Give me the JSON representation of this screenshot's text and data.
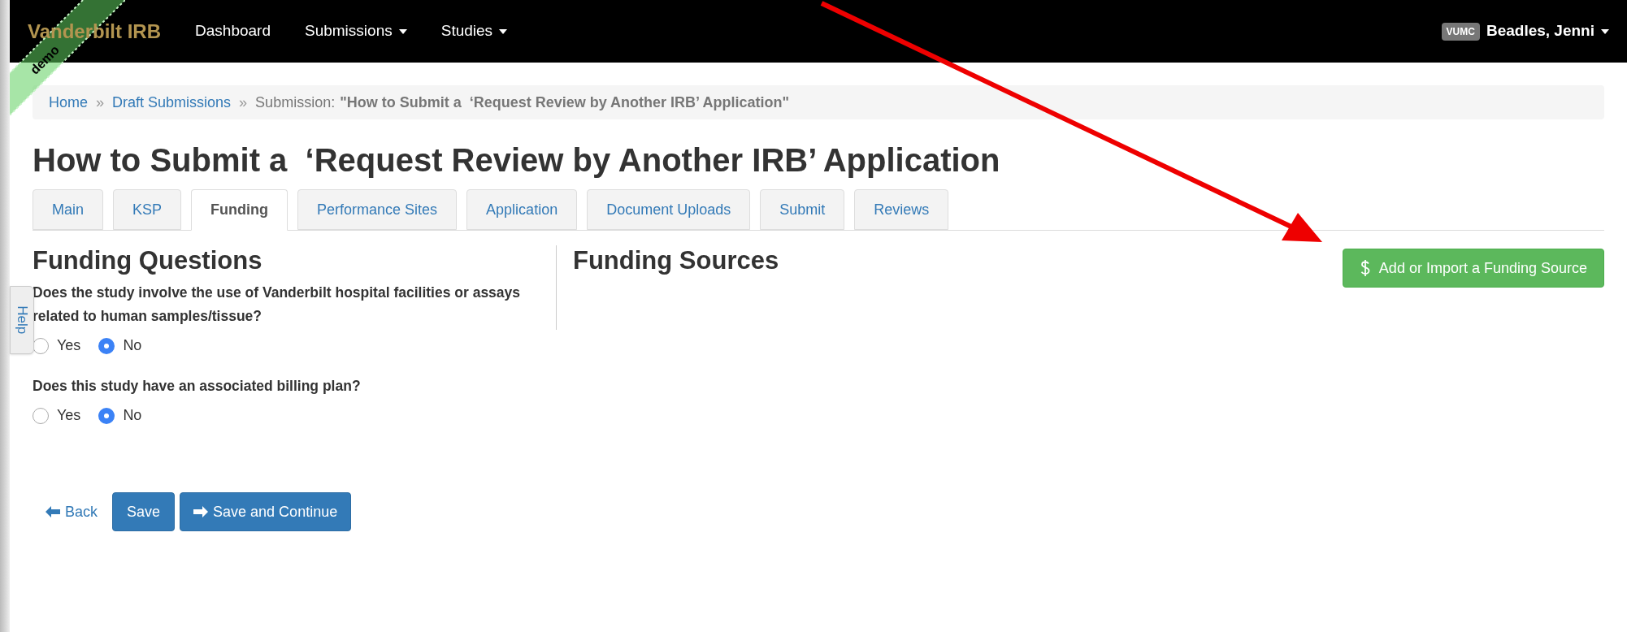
{
  "navbar": {
    "brand": "Vanderbilt IRB",
    "ribbon": "demo",
    "items": [
      {
        "label": "Dashboard",
        "dropdown": false
      },
      {
        "label": "Submissions",
        "dropdown": true
      },
      {
        "label": "Studies",
        "dropdown": true
      }
    ],
    "user_badge": "VUMC",
    "user_name": "Beadles, Jenni"
  },
  "breadcrumb": {
    "links": [
      "Home",
      "Draft Submissions"
    ],
    "separator": "»",
    "current_label": "Submission:",
    "current_value": "\"How to Submit a  ‘Request Review by Another IRB’ Application\""
  },
  "title": "How to Submit a  ‘Request Review by Another IRB’ Application",
  "tabs": [
    {
      "label": "Main",
      "selected": false
    },
    {
      "label": "KSP",
      "selected": false
    },
    {
      "label": "Funding",
      "selected": true
    },
    {
      "label": "Performance Sites",
      "selected": false
    },
    {
      "label": "Application",
      "selected": false
    },
    {
      "label": "Document Uploads",
      "selected": false
    },
    {
      "label": "Submit",
      "selected": false
    },
    {
      "label": "Reviews",
      "selected": false
    }
  ],
  "help_tab": "Help",
  "funding_questions": {
    "heading": "Funding Questions",
    "questions": [
      {
        "text": "Does the study involve the use of Vanderbilt hospital facilities or assays related to human samples/tissue?",
        "options": [
          {
            "label": "Yes",
            "selected": false
          },
          {
            "label": "No",
            "selected": true
          }
        ]
      },
      {
        "text": "Does this study have an associated billing plan?",
        "options": [
          {
            "label": "Yes",
            "selected": false
          },
          {
            "label": "No",
            "selected": true
          }
        ]
      }
    ]
  },
  "funding_sources": {
    "heading": "Funding Sources",
    "add_button": "Add or Import a Funding Source"
  },
  "actions": {
    "back": "Back",
    "save": "Save",
    "save_continue": "Save and Continue"
  }
}
